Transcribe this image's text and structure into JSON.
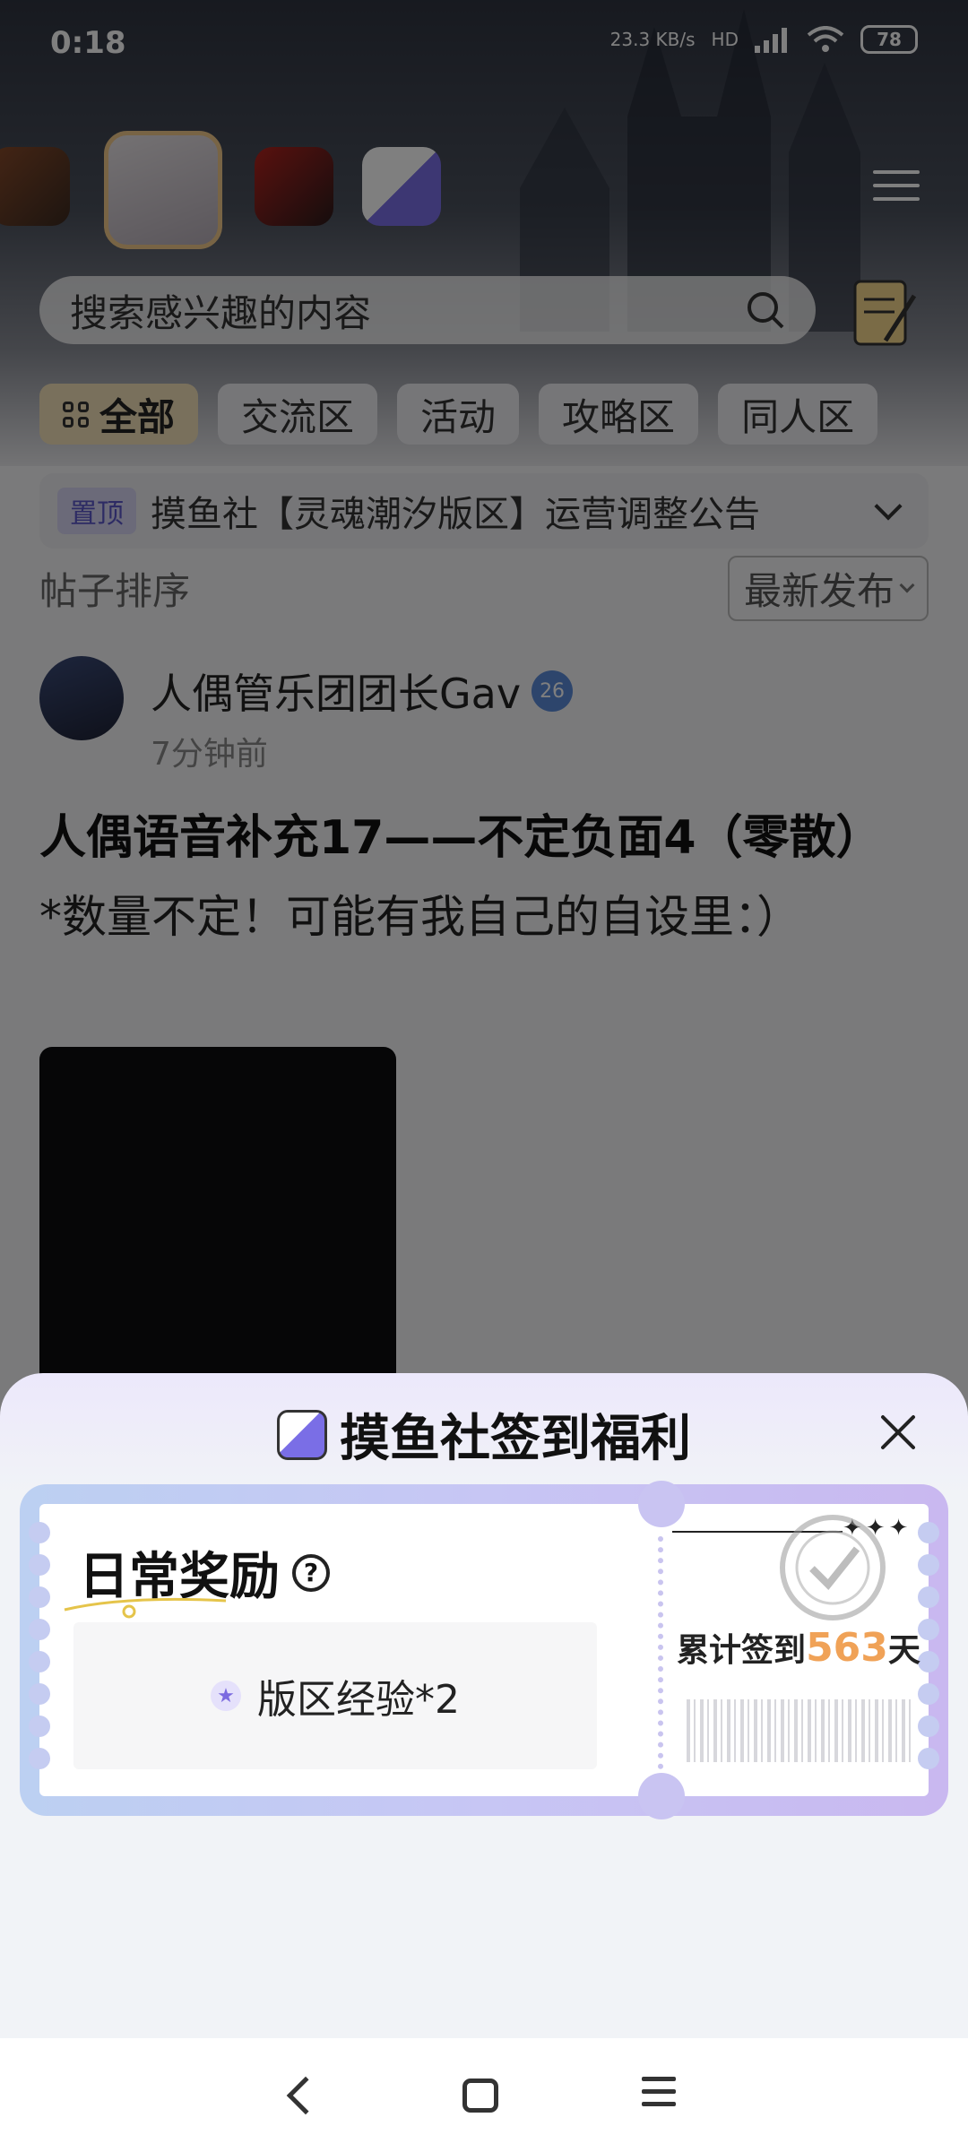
{
  "status": {
    "time": "0:18",
    "net_speed": "23.3 KB/s",
    "hd": "HD",
    "battery": "78"
  },
  "search": {
    "placeholder": "搜索感兴趣的内容"
  },
  "tabs": [
    {
      "label": "全部",
      "active": true
    },
    {
      "label": "交流区"
    },
    {
      "label": "活动"
    },
    {
      "label": "攻略区"
    },
    {
      "label": "同人区"
    }
  ],
  "notice": {
    "pin": "置顶",
    "text": "摸鱼社【灵魂潮汐版区】运营调整公告"
  },
  "sort": {
    "label": "帖子排序",
    "value": "最新发布"
  },
  "post": {
    "author": "人偶管乐团团长Gav",
    "level": "26",
    "time": "7分钟前",
    "title": "人偶语音补充17——不定负面4（零散）",
    "body": "*数量不定！可能有我自己的自设里：）"
  },
  "sheet": {
    "title": "摸鱼社签到福利",
    "reward_title": "日常奖励",
    "reward_item": "版区经验*2",
    "checkin_prefix": "累计签到",
    "checkin_days": "563",
    "checkin_suffix": "天",
    "accent": "#f0a257"
  }
}
